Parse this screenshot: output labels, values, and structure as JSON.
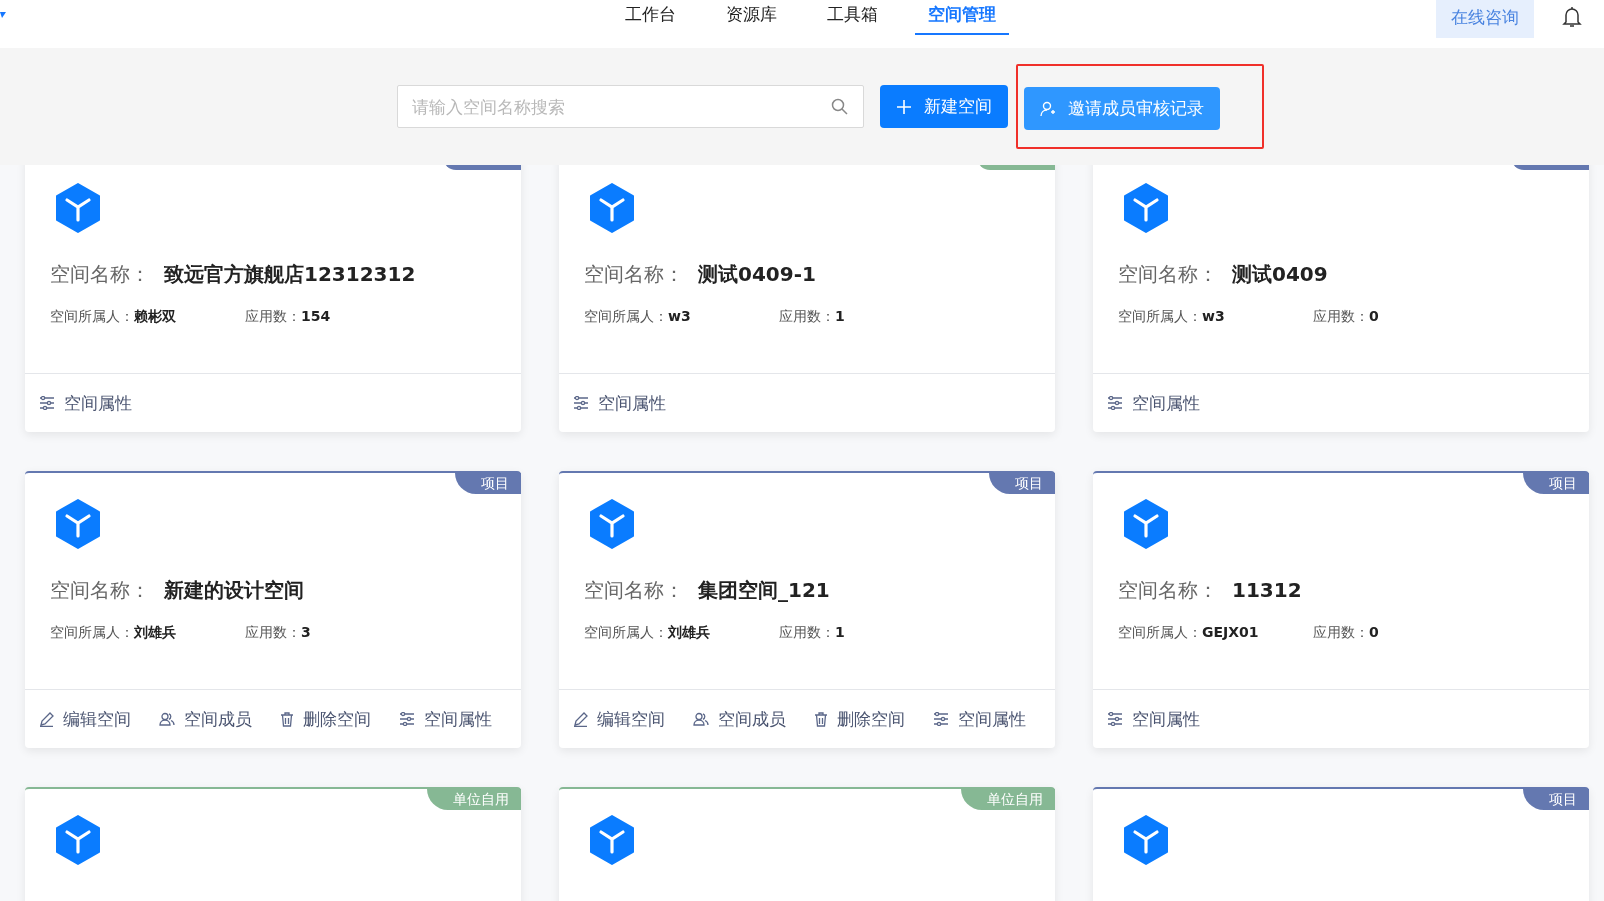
{
  "nav": {
    "items": [
      {
        "label": "工作台",
        "selected": false
      },
      {
        "label": "资源库",
        "selected": false
      },
      {
        "label": "工具箱",
        "selected": false
      },
      {
        "label": "空间管理",
        "selected": true
      }
    ]
  },
  "consult_button": "在线咨询",
  "search": {
    "placeholder": "请输入空间名称搜索"
  },
  "buttons": [
    {
      "label": "新建空间",
      "kind": "add",
      "highlighted": false
    },
    {
      "label": "邀请成员审核记录",
      "kind": "invite",
      "highlighted": true
    }
  ],
  "spaces": [
    {
      "color": "#6478b0",
      "name_label": "空间名称：",
      "name": "致远官方旗舰店12312312",
      "owner_label": "空间所属人：",
      "owner": "赖彬双",
      "apps_label": "应用数：",
      "apps": "154",
      "actions": [
        {
          "kind": "props",
          "label": "空间属性"
        }
      ]
    },
    {
      "color": "#86b894",
      "name_label": "空间名称：",
      "name": "测试0409-1",
      "owner_label": "空间所属人：",
      "owner": "w3",
      "apps_label": "应用数：",
      "apps": "1",
      "actions": [
        {
          "kind": "props",
          "label": "空间属性"
        }
      ]
    },
    {
      "color": "#6478b0",
      "name_label": "空间名称：",
      "name": "测试0409",
      "owner_label": "空间所属人：",
      "owner": "w3",
      "apps_label": "应用数：",
      "apps": "0",
      "actions": [
        {
          "kind": "props",
          "label": "空间属性"
        }
      ]
    },
    {
      "tag": "项目",
      "color": "#6478b0",
      "name_label": "空间名称：",
      "name": "新建的设计空间",
      "owner_label": "空间所属人：",
      "owner": "刘雄兵",
      "apps_label": "应用数：",
      "apps": "3",
      "actions": [
        {
          "kind": "edit",
          "label": "编辑空间"
        },
        {
          "kind": "members",
          "label": "空间成员"
        },
        {
          "kind": "delete",
          "label": "删除空间"
        },
        {
          "kind": "props",
          "label": "空间属性"
        }
      ]
    },
    {
      "tag": "项目",
      "color": "#6478b0",
      "name_label": "空间名称：",
      "name": "集团空间_121",
      "owner_label": "空间所属人：",
      "owner": "刘雄兵",
      "apps_label": "应用数：",
      "apps": "1",
      "actions": [
        {
          "kind": "edit",
          "label": "编辑空间"
        },
        {
          "kind": "members",
          "label": "空间成员"
        },
        {
          "kind": "delete",
          "label": "删除空间"
        },
        {
          "kind": "props",
          "label": "空间属性"
        }
      ]
    },
    {
      "tag": "项目",
      "color": "#6478b0",
      "name_label": "空间名称：",
      "name": "11312",
      "owner_label": "空间所属人：",
      "owner": "GEJX01",
      "apps_label": "应用数：",
      "apps": "0",
      "actions": [
        {
          "kind": "props",
          "label": "空间属性"
        }
      ]
    },
    {
      "tag": "单位自用",
      "color": "#86b894"
    },
    {
      "tag": "单位自用",
      "color": "#86b894"
    },
    {
      "tag": "项目",
      "color": "#6478b0"
    }
  ]
}
